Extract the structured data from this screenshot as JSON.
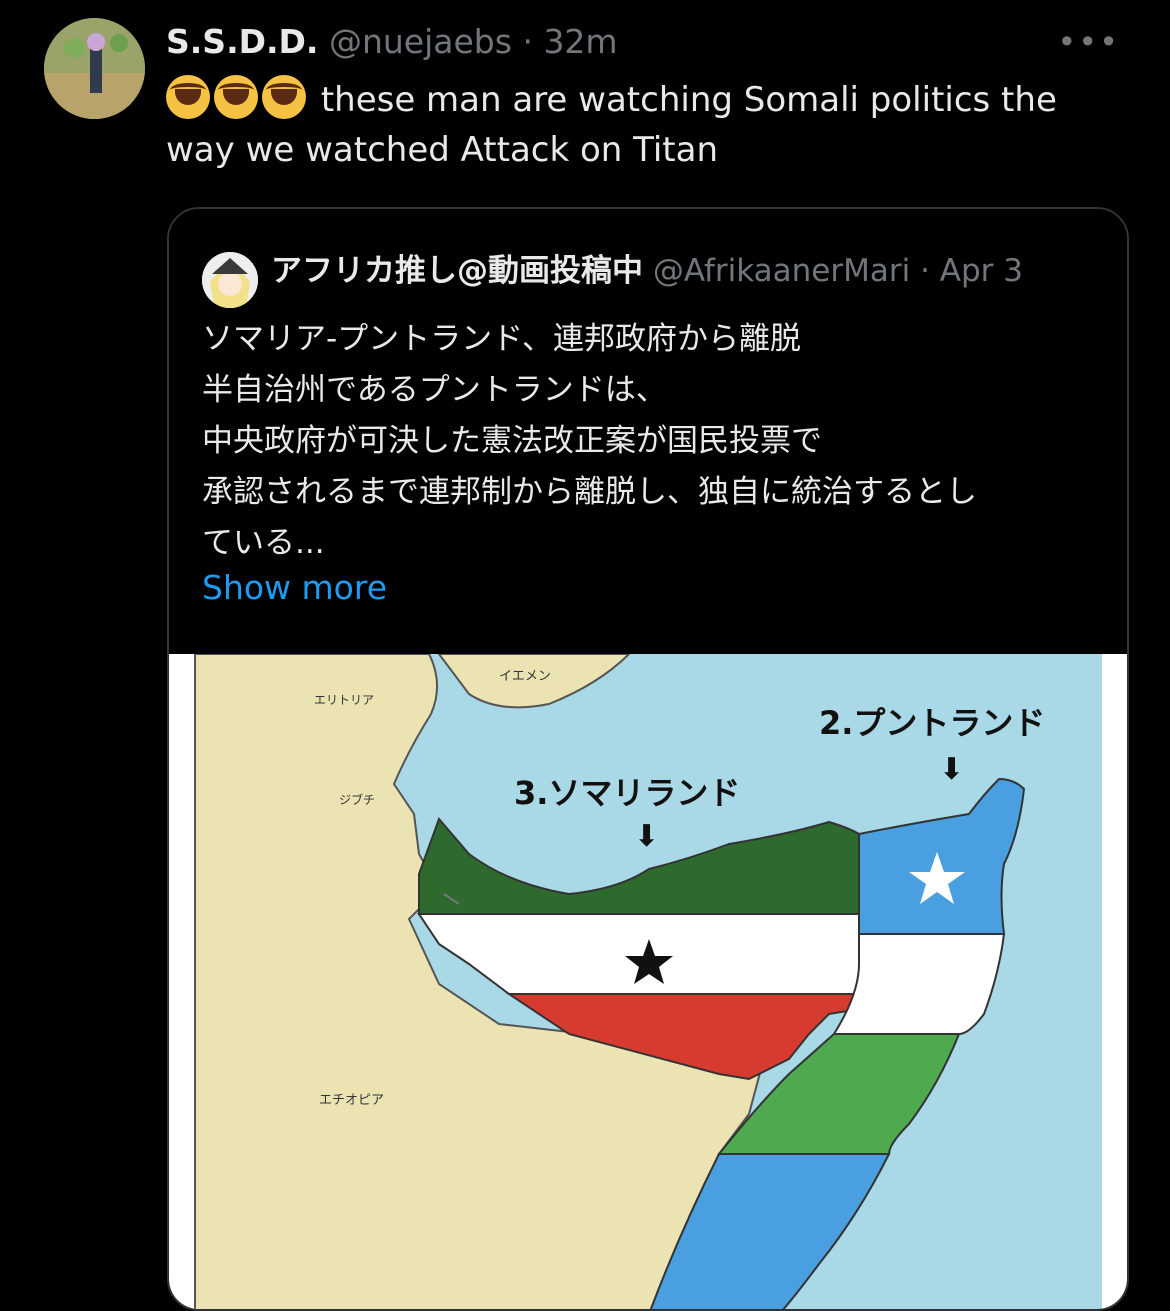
{
  "tweet": {
    "author_name": "S.S.D.D.",
    "author_handle": "@nuejaebs",
    "separator": "·",
    "time": "32m",
    "more_label": "•••",
    "text": "these man are watching Somali politics the way we watched Attack on Titan",
    "emojis": [
      "loudly-crying-face-emoji",
      "loudly-crying-face-emoji",
      "loudly-crying-face-emoji"
    ]
  },
  "quoted": {
    "author_name": "アフリカ推し@動画投稿中",
    "author_handle": "@AfrikaanerMari",
    "separator": "·",
    "date": "Apr 3",
    "lines": [
      "ソマリア-プントランド、連邦政府から離脱",
      "半自治州であるプントランドは、",
      "中央政府が可決した憲法改正案が国民投票で",
      "承認されるまで連邦制から離脱し、独自に統治するとし",
      "ている..."
    ],
    "show_more": "Show more"
  },
  "map": {
    "labels": {
      "yemen": "イエメン",
      "eritrea": "エリトリア",
      "djibouti": "ジブチ",
      "ethiopia": "エチオピア",
      "puntland": "2.プントランド",
      "somaliland": "3.ソマリランド",
      "arrow": "⬇"
    },
    "colors": {
      "sea": "#a9d8e6",
      "land": "#ece3b3",
      "somaliland_green": "#2e6a2e",
      "somaliland_red": "#d73a2f",
      "puntland_blue": "#4a9fe0",
      "puntland_green": "#4fa94f"
    }
  }
}
